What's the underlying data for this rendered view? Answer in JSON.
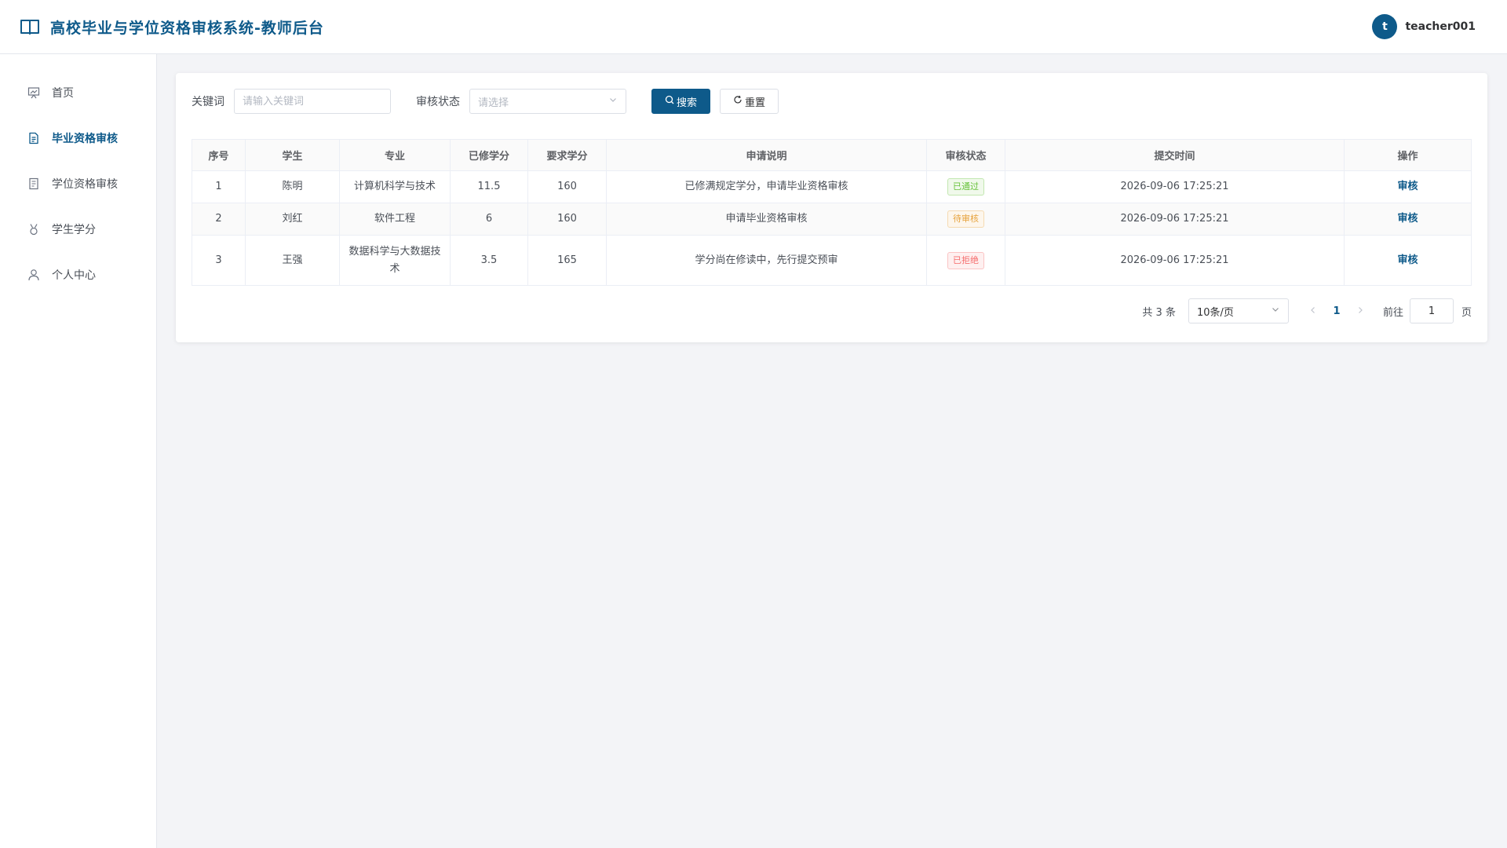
{
  "header": {
    "title": "高校毕业与学位资格审核系统-教师后台",
    "brand_icon": "open-book-icon",
    "user": {
      "avatar_initial": "t",
      "username": "teacher001"
    }
  },
  "sidebar": {
    "items": [
      {
        "label": "首页",
        "icon": "presentation-board-icon",
        "active": false
      },
      {
        "label": "毕业资格审核",
        "icon": "document-icon",
        "active": true
      },
      {
        "label": "学位资格审核",
        "icon": "list-document-icon",
        "active": false
      },
      {
        "label": "学生学分",
        "icon": "medal-icon",
        "active": false
      },
      {
        "label": "个人中心",
        "icon": "user-icon",
        "active": false
      }
    ]
  },
  "filters": {
    "keyword_label": "关键词",
    "keyword_value": "",
    "keyword_placeholder": "请输入关键词",
    "status_label": "审核状态",
    "status_placeholder": "请选择",
    "search_label": "搜索",
    "reset_label": "重置"
  },
  "table": {
    "columns": [
      "序号",
      "学生",
      "专业",
      "已修学分",
      "要求学分",
      "申请说明",
      "审核状态",
      "提交时间",
      "操作"
    ],
    "rows": [
      {
        "index": "1",
        "student": "陈明",
        "major": "计算机科学与技术",
        "earned": "11.5",
        "required": "160",
        "note": "已修满规定学分，申请毕业资格审核",
        "status": "已通过",
        "time": "2026-09-06 17:25:21",
        "action": "审核"
      },
      {
        "index": "2",
        "student": "刘红",
        "major": "软件工程",
        "earned": "6",
        "required": "160",
        "note": "申请毕业资格审核",
        "status": "待审核",
        "time": "2026-09-06 17:25:21",
        "action": "审核"
      },
      {
        "index": "3",
        "student": "王强",
        "major": "数据科学与大数据技术",
        "earned": "3.5",
        "required": "165",
        "note": "学分尚在修读中，先行提交预审",
        "status": "已拒绝",
        "time": "2026-09-06 17:25:21",
        "action": "审核"
      }
    ]
  },
  "status_colors": {
    "approved": {
      "text": "#67c23a",
      "bg": "#f0f9eb",
      "border": "#c2e7b0"
    },
    "pending": {
      "text": "#e6a23c",
      "bg": "#fdf6ec",
      "border": "#f5dab1"
    },
    "rejected": {
      "text": "#f56c6c",
      "bg": "#fef0f0",
      "border": "#fbc4c4"
    }
  },
  "pagination": {
    "total_text": "共 3 条",
    "page_size": "10条/页",
    "current_page": "1",
    "goto_label": "前往",
    "goto_value": "1",
    "goto_suffix": "页"
  },
  "accent_color": "#0e5a8a"
}
